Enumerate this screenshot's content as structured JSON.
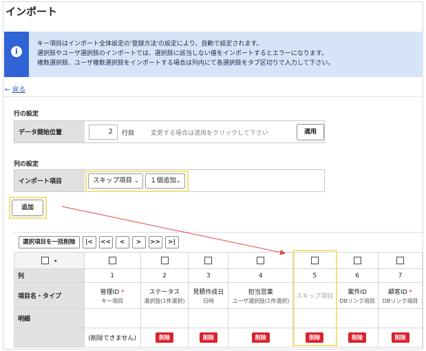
{
  "page": {
    "title": "インポート"
  },
  "notice": {
    "icon": "info-icon",
    "lines": [
      "キー項目はインポート全体設定の'登録方法'の設定により、自動で設定されます。",
      "選択肢やユーザ選択肢のインポートでは、選択肢に該当しない値をインポートするとエラーになります。",
      "複数選択肢、ユーザ複数選択肢をインポートする場合は列内にて各選択肢をタブ区切りで入力して下さい。"
    ]
  },
  "back": {
    "arrow": "←",
    "label": "戻る"
  },
  "row_settings": {
    "section_title": "行の設定",
    "label": "データ開始位置",
    "value": "2",
    "unit": "行目",
    "hint": "変更する場合は適用をクリックして下さい",
    "apply_label": "適用"
  },
  "col_settings": {
    "section_title": "列の設定",
    "label": "インポート項目",
    "item_select": "スキップ項目",
    "count_select": "１個追加",
    "add_label": "追加"
  },
  "toolbar": {
    "bulk_delete_label": "選択項目を一括削除",
    "nav": [
      "|<",
      "<<",
      "<",
      ">",
      ">>",
      ">|"
    ]
  },
  "grid": {
    "row_labels": {
      "col": "列",
      "name": "項目名・タイプ",
      "detail": "明細"
    },
    "columns": [
      {
        "num": "1",
        "name": "管理ID",
        "required": true,
        "type": "キー項目",
        "action": "(削除できません)"
      },
      {
        "num": "2",
        "name": "ステータス",
        "required": false,
        "type": "選択肢(1件選択)",
        "action": "削除"
      },
      {
        "num": "3",
        "name": "見積作成日",
        "required": false,
        "type": "日時",
        "action": "削除"
      },
      {
        "num": "4",
        "name": "担当営業",
        "required": false,
        "type": "ユーザ選択肢(1件選択)",
        "action": "削除"
      },
      {
        "num": "5",
        "name": "スキップ項目",
        "required": false,
        "type": "",
        "action": "削除"
      },
      {
        "num": "6",
        "name": "案件ID",
        "required": false,
        "type": "DBリンク項目",
        "action": "削除"
      },
      {
        "num": "7",
        "name": "顧客ID",
        "required": true,
        "type": "DBリンク項目",
        "action": "削除"
      }
    ],
    "required_mark": "*"
  },
  "colors": {
    "accent": "#2f63d6",
    "notice_bg": "#d6e4f8",
    "highlight": "#f0e27a",
    "danger": "#d9242f",
    "arrow": "#e0463c"
  }
}
